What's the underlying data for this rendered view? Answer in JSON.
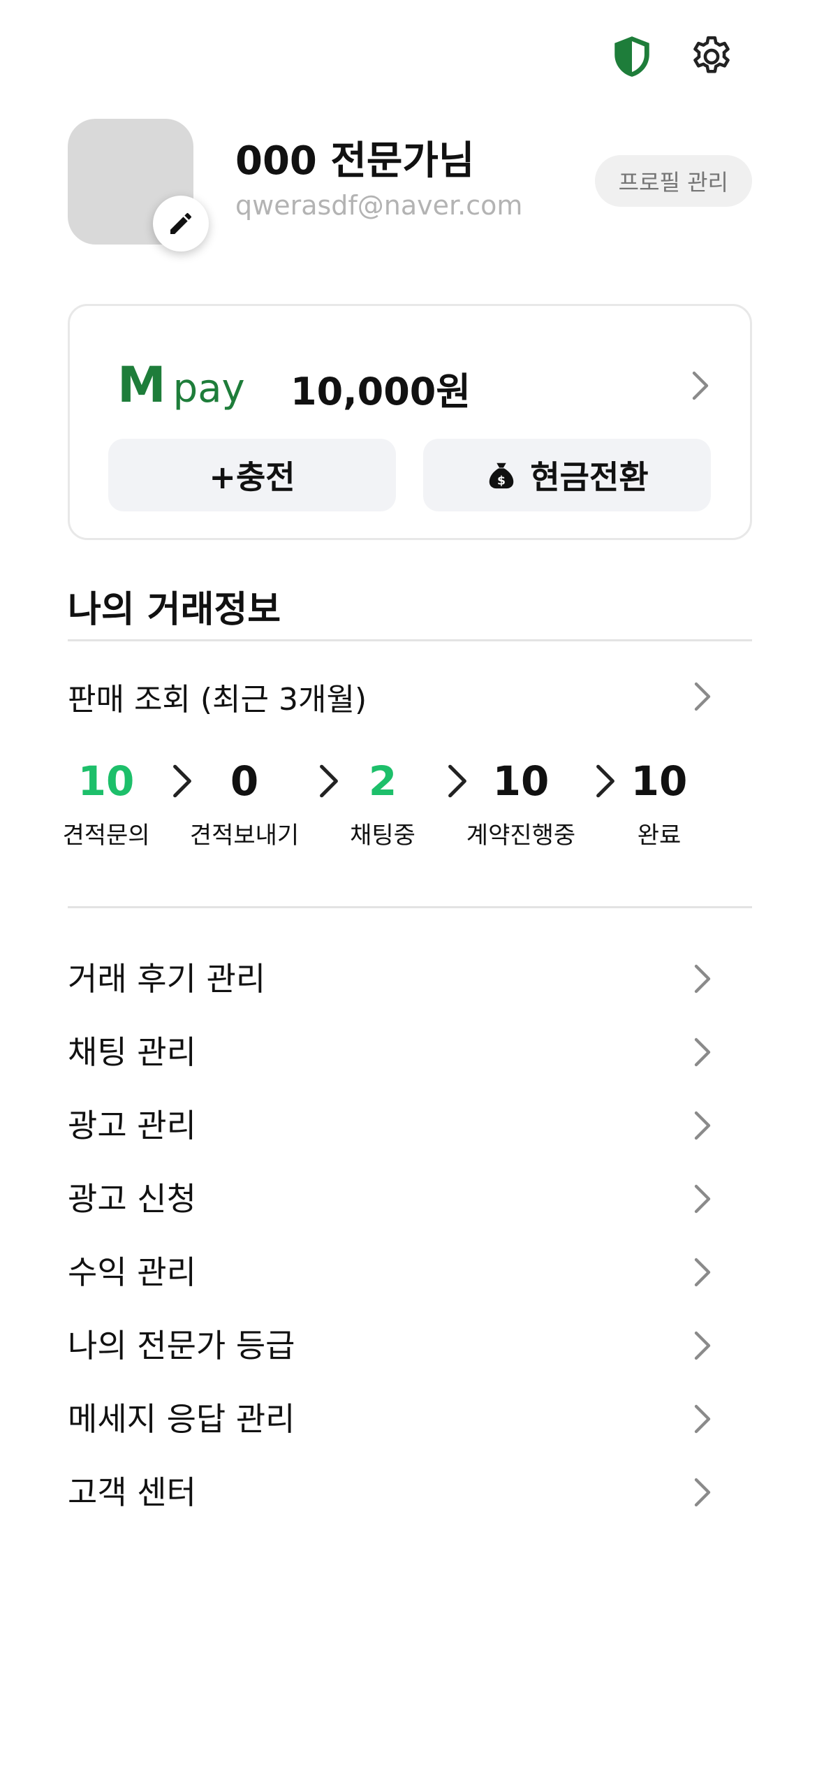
{
  "header": {
    "icons": [
      "shield-icon",
      "gear-icon"
    ],
    "accent_color": "#1e7d3a"
  },
  "profile": {
    "name": "000 전문가님",
    "email": "qwerasdf@naver.com",
    "manage_label": "프로필 관리"
  },
  "pay": {
    "logo_m": "M",
    "logo_pay": "pay",
    "balance": "10,000원",
    "charge_label": "+충전",
    "cash_label": "현금전환"
  },
  "trade": {
    "title": "나의 거래정보",
    "sales_label": "판매 조회 (최근 3개월)",
    "stats": [
      {
        "value": "10",
        "label": "견적문의",
        "highlight": true
      },
      {
        "value": "0",
        "label": "견적보내기",
        "highlight": false
      },
      {
        "value": "2",
        "label": "채팅중",
        "highlight": true
      },
      {
        "value": "10",
        "label": "계약진행중",
        "highlight": false
      },
      {
        "value": "10",
        "label": "완료",
        "highlight": false
      }
    ],
    "highlight_color": "#1dbf6a"
  },
  "menu": {
    "items": [
      {
        "label": "거래 후기 관리"
      },
      {
        "label": "채팅 관리"
      },
      {
        "label": "광고 관리"
      },
      {
        "label": "광고 신청"
      },
      {
        "label": "수익 관리"
      },
      {
        "label": "나의 전문가 등급"
      },
      {
        "label": "메세지 응답 관리"
      },
      {
        "label": "고객 센터"
      }
    ]
  }
}
